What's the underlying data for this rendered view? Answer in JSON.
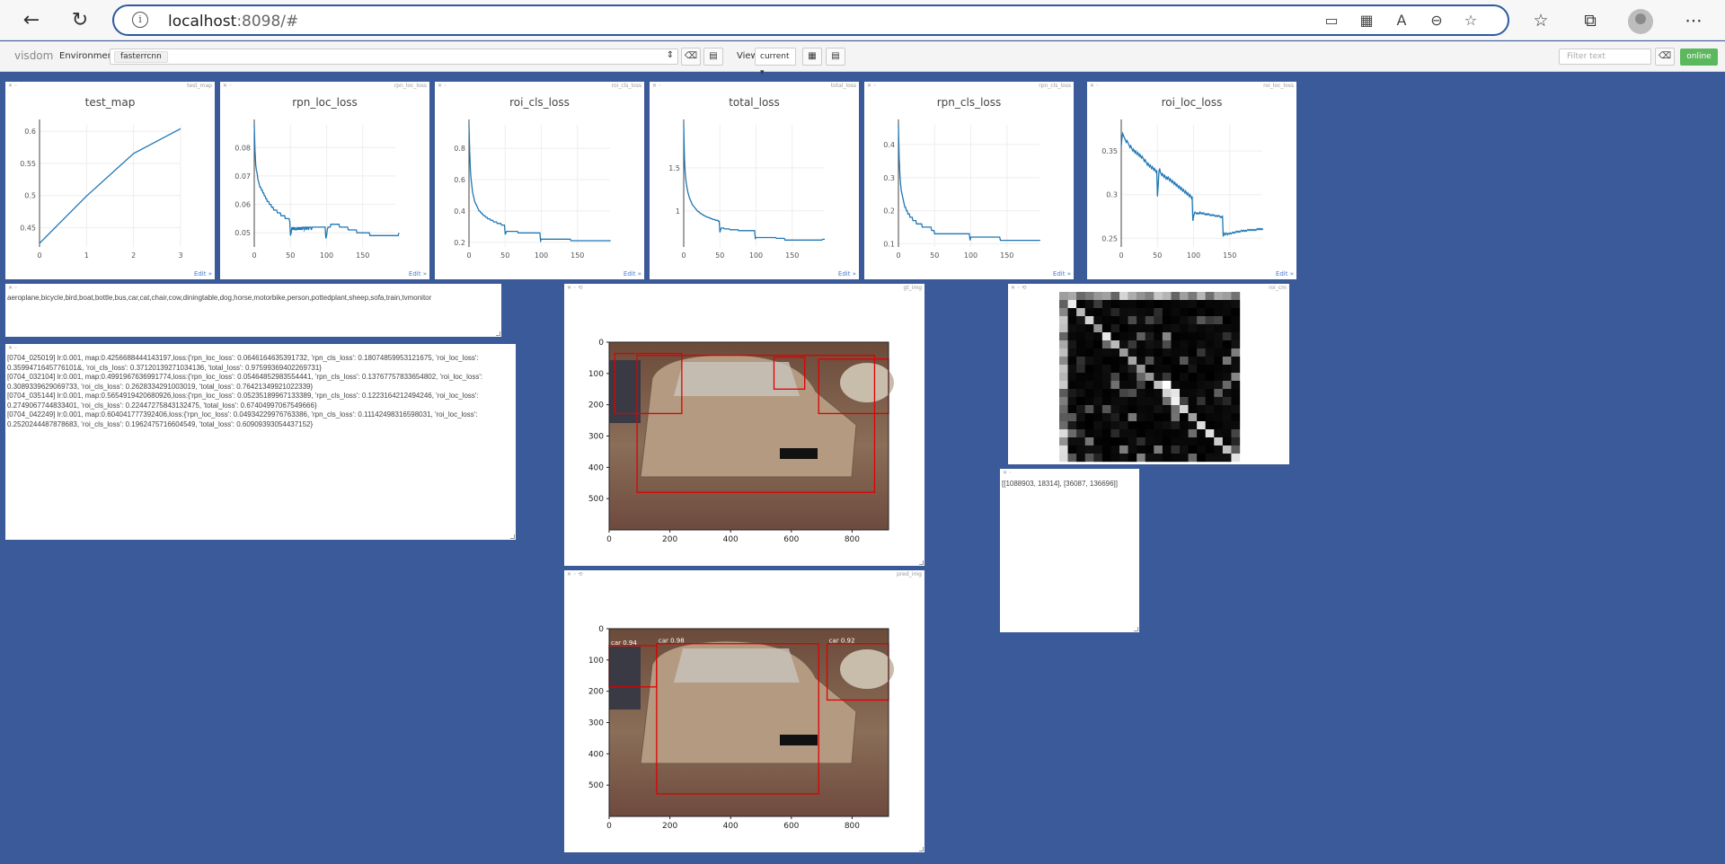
{
  "browser": {
    "url_host": "localhost",
    "url_rest": ":8098/#"
  },
  "toolbar": {
    "logo": "visdom",
    "env_label": "Environment",
    "env_value": "fasterrcnn",
    "view_label": "View",
    "view_value": "current ▾",
    "filter_placeholder": "Filter text",
    "online_label": "online"
  },
  "charts": [
    {
      "id": "test_map",
      "title": "test_map",
      "x": [
        0,
        1,
        2,
        3
      ],
      "y": [
        0.4257,
        0.4992,
        0.5654,
        0.604
      ],
      "xticks": [
        0,
        1,
        2,
        3
      ],
      "yticks": [
        0.45,
        0.5,
        0.55,
        0.6
      ],
      "xlim": [
        0,
        3
      ],
      "ylim": [
        0.42,
        0.61
      ]
    },
    {
      "id": "rpn_loc_loss",
      "title": "rpn_loc_loss",
      "xticks": [
        0,
        50,
        100,
        150
      ],
      "yticks": [
        0.05,
        0.06,
        0.07,
        0.08
      ],
      "xlim": [
        0,
        195
      ],
      "ylim": [
        0.045,
        0.088
      ],
      "y": [
        0.088,
        0.079,
        0.074,
        0.072,
        0.071,
        0.069,
        0.068,
        0.067,
        0.066,
        0.066,
        0.065,
        0.065,
        0.064,
        0.064,
        0.063,
        0.063,
        0.062,
        0.062,
        0.061,
        0.061,
        0.061,
        0.06,
        0.06,
        0.06,
        0.059,
        0.059,
        0.059,
        0.058,
        0.058,
        0.058,
        0.058,
        0.058,
        0.057,
        0.057,
        0.057,
        0.057,
        0.057,
        0.056,
        0.056,
        0.056,
        0.056,
        0.056,
        0.056,
        0.055,
        0.055,
        0.055,
        0.055,
        0.055,
        0.055,
        0.054,
        0.049,
        0.05,
        0.052,
        0.051,
        0.052,
        0.051,
        0.052,
        0.051,
        0.051,
        0.052,
        0.051,
        0.052,
        0.051,
        0.052,
        0.051,
        0.052,
        0.051,
        0.052,
        0.052,
        0.051,
        0.052,
        0.052,
        0.051,
        0.052,
        0.052,
        0.051,
        0.052,
        0.052,
        0.052,
        0.051,
        0.052,
        0.052,
        0.052,
        0.052,
        0.052,
        0.052,
        0.052,
        0.052,
        0.052,
        0.052,
        0.052,
        0.052,
        0.052,
        0.052,
        0.052,
        0.052,
        0.052,
        0.052,
        0.052,
        0.048,
        0.049,
        0.051,
        0.052,
        0.052,
        0.052,
        0.052,
        0.053,
        0.053,
        0.053,
        0.053,
        0.053,
        0.053,
        0.053,
        0.053,
        0.053,
        0.053,
        0.053,
        0.053,
        0.052,
        0.052,
        0.052,
        0.052,
        0.052,
        0.052,
        0.052,
        0.052,
        0.052,
        0.052,
        0.052,
        0.052,
        0.051,
        0.051,
        0.051,
        0.051,
        0.051,
        0.051,
        0.051,
        0.051,
        0.051,
        0.051,
        0.051,
        0.051,
        0.05,
        0.05,
        0.05,
        0.05,
        0.05,
        0.05,
        0.05,
        0.05,
        0.05,
        0.05,
        0.05,
        0.05,
        0.05,
        0.05,
        0.05,
        0.05,
        0.05,
        0.05,
        0.049,
        0.049,
        0.049,
        0.049,
        0.049,
        0.049,
        0.049,
        0.049,
        0.049,
        0.049,
        0.049,
        0.049,
        0.049,
        0.049,
        0.049,
        0.049,
        0.049,
        0.049,
        0.049,
        0.049,
        0.049,
        0.049,
        0.049,
        0.049,
        0.049,
        0.049,
        0.049,
        0.049,
        0.049,
        0.049,
        0.049,
        0.049,
        0.049,
        0.049,
        0.049,
        0.049,
        0.049,
        0.049,
        0.049,
        0.049,
        0.05
      ]
    },
    {
      "id": "roi_cls_loss",
      "title": "roi_cls_loss",
      "xticks": [
        0,
        50,
        100,
        150
      ],
      "yticks": [
        0.2,
        0.4,
        0.6,
        0.8
      ],
      "xlim": [
        0,
        195
      ],
      "ylim": [
        0.17,
        0.95
      ],
      "y": [
        0.95,
        0.78,
        0.66,
        0.6,
        0.56,
        0.52,
        0.5,
        0.48,
        0.46,
        0.45,
        0.44,
        0.43,
        0.42,
        0.41,
        0.4,
        0.4,
        0.39,
        0.39,
        0.38,
        0.38,
        0.37,
        0.37,
        0.37,
        0.36,
        0.36,
        0.36,
        0.35,
        0.35,
        0.35,
        0.35,
        0.34,
        0.34,
        0.34,
        0.34,
        0.33,
        0.33,
        0.33,
        0.33,
        0.33,
        0.32,
        0.32,
        0.32,
        0.32,
        0.32,
        0.32,
        0.31,
        0.31,
        0.31,
        0.31,
        0.31,
        0.25,
        0.26,
        0.27,
        0.27,
        0.27,
        0.27,
        0.27,
        0.27,
        0.27,
        0.27,
        0.27,
        0.27,
        0.27,
        0.27,
        0.27,
        0.27,
        0.27,
        0.27,
        0.26,
        0.26,
        0.26,
        0.26,
        0.26,
        0.26,
        0.26,
        0.26,
        0.26,
        0.26,
        0.26,
        0.26,
        0.26,
        0.26,
        0.26,
        0.26,
        0.26,
        0.26,
        0.26,
        0.26,
        0.26,
        0.26,
        0.26,
        0.26,
        0.26,
        0.26,
        0.26,
        0.26,
        0.26,
        0.26,
        0.26,
        0.21,
        0.22,
        0.22,
        0.22,
        0.22,
        0.22,
        0.22,
        0.22,
        0.22,
        0.22,
        0.22,
        0.22,
        0.22,
        0.22,
        0.22,
        0.22,
        0.22,
        0.22,
        0.22,
        0.22,
        0.22,
        0.22,
        0.22,
        0.22,
        0.22,
        0.22,
        0.22,
        0.22,
        0.22,
        0.22,
        0.22,
        0.22,
        0.22,
        0.22,
        0.22,
        0.22,
        0.22,
        0.22,
        0.22,
        0.22,
        0.22,
        0.22,
        0.21,
        0.21,
        0.21,
        0.21,
        0.21,
        0.21,
        0.21,
        0.21,
        0.21,
        0.21,
        0.21,
        0.21,
        0.21,
        0.21,
        0.21,
        0.21,
        0.21,
        0.21,
        0.21,
        0.21,
        0.21,
        0.21,
        0.21,
        0.21,
        0.21,
        0.21,
        0.21,
        0.21,
        0.21,
        0.21,
        0.21,
        0.21,
        0.21,
        0.21,
        0.21,
        0.21,
        0.21,
        0.21,
        0.21,
        0.21,
        0.21,
        0.21,
        0.21,
        0.21,
        0.21,
        0.21,
        0.21,
        0.21,
        0.21,
        0.21,
        0.21,
        0.21,
        0.21,
        0.21,
        0.21,
        0.21
      ]
    },
    {
      "id": "total_loss",
      "title": "total_loss",
      "xticks": [
        0,
        50,
        100,
        150
      ],
      "yticks": [
        1,
        1.5
      ],
      "xlim": [
        0,
        195
      ],
      "ylim": [
        0.58,
        2.0
      ],
      "y": [
        2.0,
        1.62,
        1.45,
        1.36,
        1.3,
        1.25,
        1.21,
        1.18,
        1.15,
        1.13,
        1.11,
        1.09,
        1.07,
        1.06,
        1.05,
        1.04,
        1.03,
        1.02,
        1.01,
        1.0,
        0.99,
        0.99,
        0.98,
        0.97,
        0.97,
        0.96,
        0.96,
        0.95,
        0.95,
        0.94,
        0.94,
        0.93,
        0.93,
        0.93,
        0.92,
        0.92,
        0.92,
        0.91,
        0.91,
        0.91,
        0.9,
        0.9,
        0.9,
        0.9,
        0.89,
        0.89,
        0.89,
        0.89,
        0.88,
        0.88,
        0.75,
        0.78,
        0.8,
        0.8,
        0.8,
        0.8,
        0.79,
        0.79,
        0.79,
        0.79,
        0.79,
        0.79,
        0.79,
        0.79,
        0.78,
        0.78,
        0.78,
        0.78,
        0.78,
        0.78,
        0.78,
        0.78,
        0.78,
        0.78,
        0.78,
        0.78,
        0.77,
        0.77,
        0.77,
        0.77,
        0.77,
        0.77,
        0.77,
        0.77,
        0.77,
        0.77,
        0.77,
        0.77,
        0.77,
        0.77,
        0.77,
        0.77,
        0.77,
        0.77,
        0.77,
        0.77,
        0.77,
        0.77,
        0.77,
        0.68,
        0.69,
        0.69,
        0.69,
        0.69,
        0.69,
        0.69,
        0.69,
        0.69,
        0.69,
        0.69,
        0.69,
        0.69,
        0.69,
        0.69,
        0.69,
        0.69,
        0.69,
        0.69,
        0.69,
        0.69,
        0.69,
        0.69,
        0.69,
        0.69,
        0.69,
        0.69,
        0.69,
        0.69,
        0.68,
        0.68,
        0.68,
        0.68,
        0.68,
        0.68,
        0.68,
        0.68,
        0.68,
        0.68,
        0.68,
        0.68,
        0.66,
        0.66,
        0.66,
        0.66,
        0.66,
        0.66,
        0.66,
        0.66,
        0.66,
        0.66,
        0.66,
        0.66,
        0.66,
        0.66,
        0.66,
        0.66,
        0.66,
        0.66,
        0.66,
        0.66,
        0.66,
        0.66,
        0.66,
        0.66,
        0.66,
        0.66,
        0.66,
        0.66,
        0.66,
        0.66,
        0.66,
        0.66,
        0.66,
        0.66,
        0.66,
        0.66,
        0.66,
        0.66,
        0.66,
        0.66,
        0.66,
        0.66,
        0.66,
        0.66,
        0.66,
        0.66,
        0.66,
        0.66,
        0.66,
        0.66,
        0.66,
        0.66,
        0.67,
        0.67,
        0.67,
        0.67
      ]
    },
    {
      "id": "rpn_cls_loss",
      "title": "rpn_cls_loss",
      "xticks": [
        0,
        50,
        100,
        150
      ],
      "yticks": [
        0.1,
        0.2,
        0.3,
        0.4
      ],
      "xlim": [
        0,
        195
      ],
      "ylim": [
        0.09,
        0.46
      ],
      "y": [
        0.46,
        0.36,
        0.31,
        0.28,
        0.26,
        0.25,
        0.24,
        0.23,
        0.22,
        0.21,
        0.21,
        0.2,
        0.2,
        0.19,
        0.19,
        0.19,
        0.18,
        0.18,
        0.18,
        0.18,
        0.17,
        0.17,
        0.17,
        0.17,
        0.17,
        0.16,
        0.16,
        0.16,
        0.16,
        0.16,
        0.16,
        0.16,
        0.16,
        0.15,
        0.15,
        0.15,
        0.15,
        0.15,
        0.15,
        0.15,
        0.15,
        0.15,
        0.15,
        0.15,
        0.15,
        0.15,
        0.14,
        0.14,
        0.14,
        0.14,
        0.13,
        0.13,
        0.13,
        0.13,
        0.13,
        0.13,
        0.13,
        0.13,
        0.13,
        0.13,
        0.13,
        0.13,
        0.13,
        0.13,
        0.13,
        0.13,
        0.13,
        0.13,
        0.13,
        0.13,
        0.13,
        0.13,
        0.13,
        0.13,
        0.13,
        0.13,
        0.13,
        0.13,
        0.13,
        0.13,
        0.13,
        0.13,
        0.13,
        0.13,
        0.13,
        0.13,
        0.13,
        0.13,
        0.13,
        0.13,
        0.13,
        0.13,
        0.13,
        0.13,
        0.13,
        0.13,
        0.13,
        0.13,
        0.13,
        0.11,
        0.12,
        0.12,
        0.12,
        0.12,
        0.12,
        0.12,
        0.12,
        0.12,
        0.12,
        0.12,
        0.12,
        0.12,
        0.12,
        0.12,
        0.12,
        0.12,
        0.12,
        0.12,
        0.12,
        0.12,
        0.12,
        0.12,
        0.12,
        0.12,
        0.12,
        0.12,
        0.12,
        0.12,
        0.12,
        0.12,
        0.12,
        0.12,
        0.12,
        0.12,
        0.12,
        0.12,
        0.12,
        0.12,
        0.12,
        0.12,
        0.12,
        0.11,
        0.11,
        0.11,
        0.11,
        0.11,
        0.11,
        0.11,
        0.11,
        0.11,
        0.11,
        0.11,
        0.11,
        0.11,
        0.11,
        0.11,
        0.11,
        0.11,
        0.11,
        0.11,
        0.11,
        0.11,
        0.11,
        0.11,
        0.11,
        0.11,
        0.11,
        0.11,
        0.11,
        0.11,
        0.11,
        0.11,
        0.11,
        0.11,
        0.11,
        0.11,
        0.11,
        0.11,
        0.11,
        0.11,
        0.11,
        0.11,
        0.11,
        0.11,
        0.11,
        0.11,
        0.11,
        0.11,
        0.11,
        0.11,
        0.11,
        0.11,
        0.11,
        0.11,
        0.11,
        0.11,
        0.11
      ]
    },
    {
      "id": "roi_loc_loss",
      "title": "roi_loc_loss",
      "xticks": [
        0,
        50,
        100,
        150
      ],
      "yticks": [
        0.25,
        0.3,
        0.35
      ],
      "xlim": [
        0,
        195
      ],
      "ylim": [
        0.24,
        0.38
      ],
      "y": [
        0.355,
        0.365,
        0.37,
        0.368,
        0.366,
        0.364,
        0.362,
        0.36,
        0.362,
        0.36,
        0.358,
        0.356,
        0.354,
        0.356,
        0.354,
        0.352,
        0.35,
        0.352,
        0.35,
        0.348,
        0.35,
        0.348,
        0.346,
        0.348,
        0.346,
        0.344,
        0.346,
        0.344,
        0.342,
        0.344,
        0.342,
        0.34,
        0.338,
        0.34,
        0.338,
        0.336,
        0.334,
        0.336,
        0.334,
        0.332,
        0.334,
        0.332,
        0.33,
        0.332,
        0.33,
        0.328,
        0.33,
        0.328,
        0.326,
        0.328,
        0.298,
        0.31,
        0.325,
        0.33,
        0.326,
        0.324,
        0.322,
        0.324,
        0.322,
        0.32,
        0.322,
        0.32,
        0.318,
        0.32,
        0.318,
        0.32,
        0.318,
        0.316,
        0.318,
        0.316,
        0.314,
        0.316,
        0.314,
        0.312,
        0.314,
        0.312,
        0.31,
        0.312,
        0.31,
        0.308,
        0.31,
        0.308,
        0.306,
        0.308,
        0.306,
        0.304,
        0.306,
        0.304,
        0.302,
        0.304,
        0.302,
        0.3,
        0.302,
        0.3,
        0.298,
        0.3,
        0.298,
        0.296,
        0.298,
        0.27,
        0.275,
        0.278,
        0.28,
        0.279,
        0.278,
        0.279,
        0.278,
        0.279,
        0.278,
        0.28,
        0.279,
        0.278,
        0.279,
        0.278,
        0.279,
        0.278,
        0.277,
        0.278,
        0.277,
        0.278,
        0.277,
        0.278,
        0.277,
        0.276,
        0.277,
        0.276,
        0.277,
        0.276,
        0.277,
        0.276,
        0.275,
        0.276,
        0.275,
        0.276,
        0.275,
        0.276,
        0.275,
        0.274,
        0.275,
        0.274,
        0.275,
        0.252,
        0.255,
        0.256,
        0.254,
        0.255,
        0.256,
        0.254,
        0.255,
        0.256,
        0.255,
        0.256,
        0.255,
        0.256,
        0.257,
        0.256,
        0.257,
        0.256,
        0.257,
        0.258,
        0.257,
        0.258,
        0.257,
        0.258,
        0.257,
        0.258,
        0.259,
        0.258,
        0.259,
        0.258,
        0.259,
        0.258,
        0.259,
        0.258,
        0.259,
        0.26,
        0.259,
        0.26,
        0.259,
        0.26,
        0.259,
        0.26,
        0.259,
        0.26,
        0.259,
        0.26,
        0.259,
        0.26,
        0.261,
        0.26,
        0.261,
        0.26,
        0.261,
        0.26,
        0.261,
        0.26,
        0.261
      ]
    }
  ],
  "labels_pane": {
    "text": "aeroplane,bicycle,bird,boat,bottle,bus,car,cat,chair,cow,diningtable,dog,horse,motorbike,person,pottedplant,sheep,sofa,train,tvmonitor"
  },
  "log_pane": {
    "lines": [
      "[0704_025019] lr:0.001, map:0.4256688444143197,loss:{'rpn_loc_loss': 0.0646164635391732, 'rpn_cls_loss': 0.18074859953121675, 'roi_loc_loss':",
      "0.3599471645776101&, 'roi_cls_loss': 0.37120139271034136, 'total_loss': 0.97599369402269731}",
      "[0704_032104] lr:0.001, map:0.4991967636991774,loss:{'rpn_loc_loss': 0.05464852983554441, 'rpn_cls_loss': 0.13767757833654802, 'roi_loc_loss':",
      "0.3089339629069733, 'roi_cls_loss': 0.2628334291003019, 'total_loss': 0.76421349921022339}",
      "[0704_035144] lr:0.001, map:0.5654919420680926,loss:{'rpn_loc_loss': 0.05235189967133389, 'rpn_cls_loss': 0.1223164212494246, 'roi_loc_loss':",
      "0.2749067744833401, 'roi_cls_loss': 0.22447275843132475, 'total_loss': 0.67404997067549666}",
      "[0704_042249] lr:0.001, map:0.604041777392406,loss:{'rpn_loc_loss': 0.04934229976763386, 'rpn_cls_loss': 0.11142498316598031, 'roi_loc_loss':",
      "0.2520244487878683, 'roi_cls_loss': 0.1962475716604549, 'total_loss': 0.60909393054437152}"
    ]
  },
  "gt_img_pane": {
    "title": "gt_img",
    "xticks": [
      "0",
      "200",
      "400",
      "600",
      "800"
    ],
    "yticks": [
      "0",
      "100",
      "200",
      "300",
      "400",
      "500"
    ]
  },
  "pred_img_pane": {
    "title": "pred_img",
    "xticks": [
      "0",
      "200",
      "400",
      "600",
      "800"
    ],
    "yticks": [
      "0",
      "100",
      "200",
      "300",
      "400",
      "500"
    ],
    "box_labels": [
      "car 0.94",
      "car 0.98",
      "car 0.92"
    ]
  },
  "roi_cm_pane": {
    "title": "roi_cm"
  },
  "counts_pane": {
    "text": "[[1088903, 18314], [36087, 136696]]"
  },
  "colors": {
    "line": "#1f77b4",
    "background": "#3b5a9a",
    "box": "#e00000",
    "online": "#5cb85c"
  }
}
